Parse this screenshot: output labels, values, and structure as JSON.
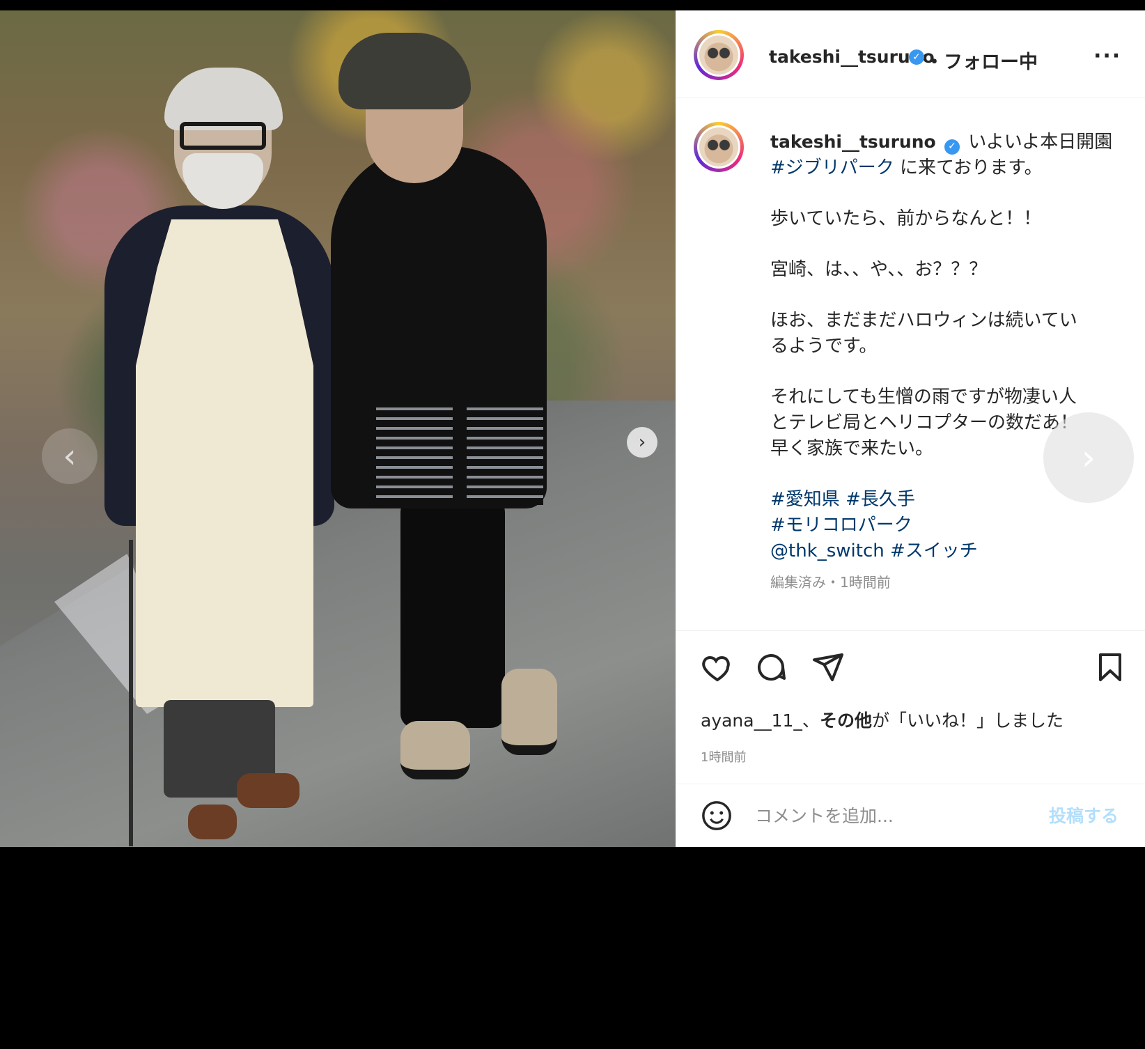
{
  "post": {
    "username": "takeshi__tsuruno",
    "follow_status": "・フォロー中",
    "more_label": "···"
  },
  "caption": {
    "first_line": "いよいよ本日開園",
    "line_2_hashtag": "#ジブリパーク",
    "line_2_rest": " に来ております。",
    "line_3": "歩いていたら、前からなんと！！",
    "line_4": "宮崎、は、、や、、お？？？",
    "line_5": "ほお、まだまだハロウィンは続いてい",
    "line_6": "るようです。",
    "line_7": "それにしても生憎の雨ですが物凄い人",
    "line_8": "とテレビ局とヘリコプターの数だあ！",
    "line_9": "早く家族で来たい。",
    "tags_1a": "#愛知県",
    "tags_1b": "#長久手",
    "tags_2": "#モリコロパーク",
    "tags_3a": "@thk_switch",
    "tags_3b": "#スイッチ"
  },
  "edited_label": "編集済み・1時間前",
  "icons": {
    "like": "heart-icon",
    "comment": "comment-icon",
    "share": "send-icon",
    "save": "bookmark-icon",
    "emoji": "emoji-icon",
    "prev": "chevron-left-icon",
    "next": "chevron-right-icon"
  },
  "likes": {
    "user": "ayana__11_",
    "separator": "、",
    "others": "その他",
    "suffix": "が「いいね！」しました"
  },
  "time_ago": "1時間前",
  "comment": {
    "placeholder": "コメントを追加...",
    "post_label": "投稿する"
  },
  "colors": {
    "link": "#00376b",
    "verified": "#3897f0",
    "post_button": "#b2dffc"
  }
}
